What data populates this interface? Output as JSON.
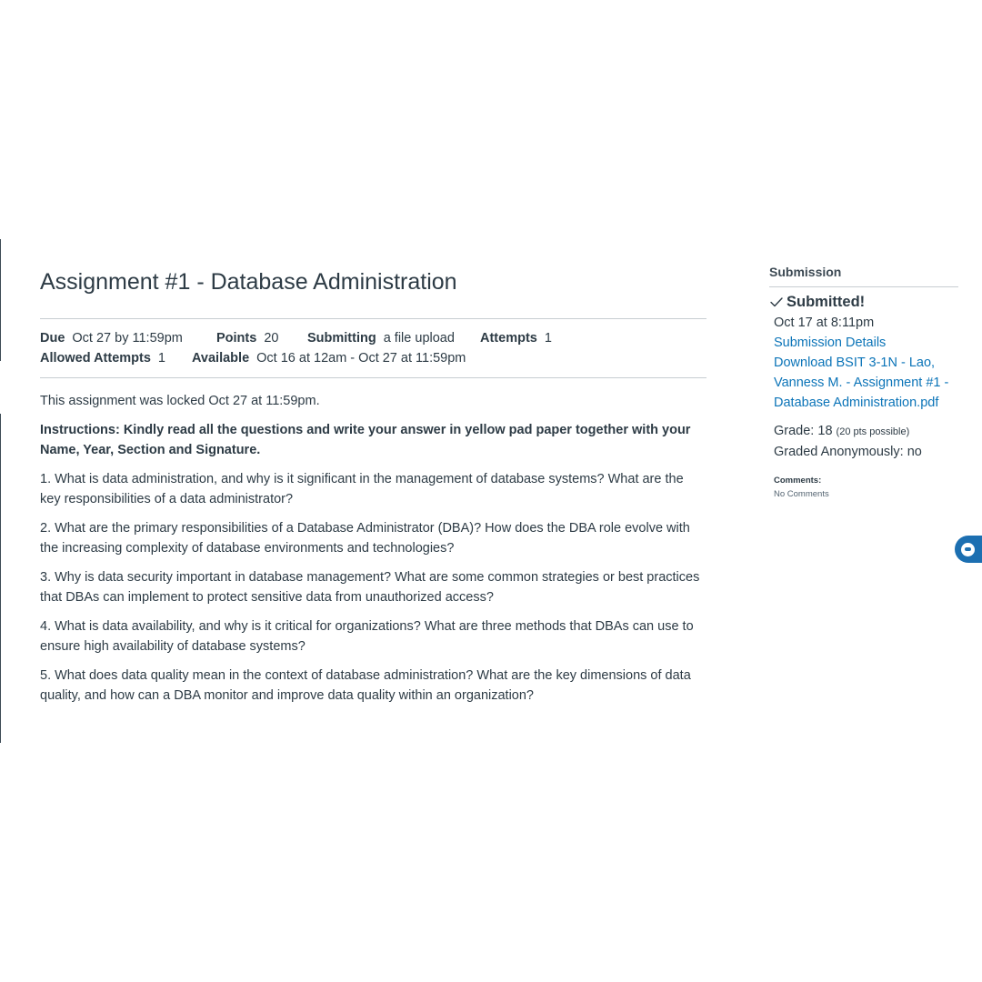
{
  "assignment": {
    "title": "Assignment #1 - Database Administration",
    "details": {
      "due_label": "Due",
      "due_value": "Oct 27 by 11:59pm",
      "points_label": "Points",
      "points_value": "20",
      "submitting_label": "Submitting",
      "submitting_value": "a file upload",
      "attempts_label": "Attempts",
      "attempts_value": "1",
      "allowed_attempts_label": "Allowed Attempts",
      "allowed_attempts_value": "1",
      "available_label": "Available",
      "available_value": "Oct 16 at 12am - Oct 27 at 11:59pm"
    },
    "locked_notice": "This assignment was locked Oct 27 at 11:59pm.",
    "instructions": "Instructions: Kindly read all the questions and write your answer in yellow pad paper together with your Name, Year, Section and Signature.",
    "questions": [
      "1. What is data administration, and why is it significant in the management of database systems? What are the key responsibilities of a data administrator?",
      "2. What are the primary responsibilities of a Database Administrator (DBA)? How does the DBA role evolve with the increasing complexity of database environments and technologies?",
      "3. Why is data security important in database management? What are some common strategies or best practices that DBAs can implement to protect sensitive data from unauthorized access?",
      "4. What is data availability, and why is it critical for organizations? What are three methods that DBAs can use to ensure high availability of database systems?",
      "5. What does data quality mean in the context of database administration? What are the key dimensions of data quality, and how can a DBA monitor and improve data quality within an organization?"
    ]
  },
  "submission": {
    "heading": "Submission",
    "status": "Submitted!",
    "status_icon": "checkmark-icon",
    "date": "Oct 17 at 8:11pm",
    "details_link": "Submission Details",
    "download_link": "Download BSIT 3-1N - Lao, Vanness M. - Assignment #1 - Database Administration.pdf",
    "grade_label": "Grade:",
    "grade_value": "18",
    "grade_possible": "(20 pts possible)",
    "graded_anonymously": "Graded Anonymously: no",
    "comments_label": "Comments:",
    "comments_value": "No Comments"
  },
  "widgets": {
    "chat_icon": "chat-bubble-icon"
  },
  "colors": {
    "text": "#2d3b45",
    "link": "#0b74b8",
    "divider": "#c7cdd1",
    "chat_widget": "#1c6fb1"
  }
}
